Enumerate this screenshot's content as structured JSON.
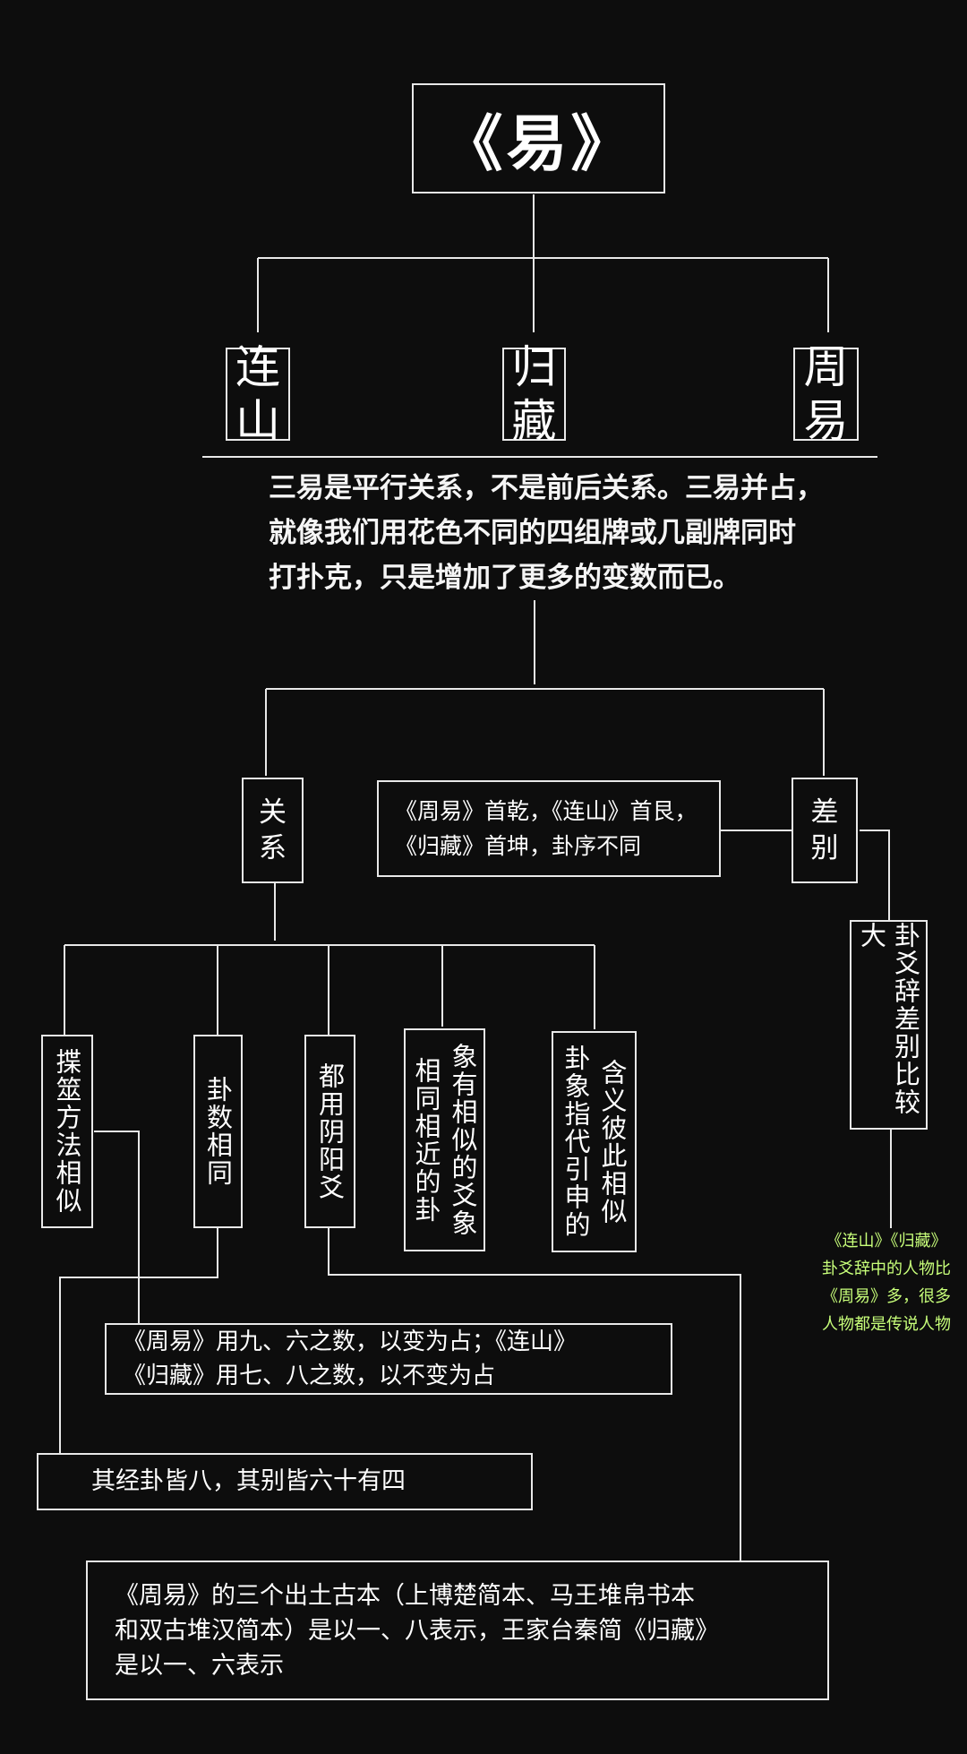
{
  "root": {
    "title": "《易》"
  },
  "books": {
    "lianshan": [
      "连",
      "山"
    ],
    "guicang": [
      "归",
      "藏"
    ],
    "zhouyi": [
      "周",
      "易"
    ]
  },
  "summary": {
    "line1": "三易是平行关系，不是前后关系。三易并占，",
    "line2": "就像我们用花色不同的四组牌或几副牌同时",
    "line3": "打扑克，只是增加了更多的变数而已。"
  },
  "relation": {
    "label": [
      "关",
      "系"
    ]
  },
  "difference": {
    "label": [
      "差",
      "别"
    ],
    "sequence_line1": "《周易》首乾，《连山》首艮，",
    "sequence_line2": "《归藏》首坤，卦序不同",
    "detail": "卦爻辞差别比较大",
    "note_line1": "《连山》《归藏》",
    "note_line2": "卦爻辞中的人物比",
    "note_line3": "《周易》多，很多",
    "note_line4": "人物都是传说人物"
  },
  "similarities": {
    "item1": "揲筮方法相似",
    "item2": "卦数相同",
    "item3": "都用阴阳爻",
    "item4_col1": "相同相近的卦",
    "item4_col2": "象有相似的爻象",
    "item5_col1": "卦象指代引申的",
    "item5_col2": "含义彼此相似"
  },
  "details": {
    "method_line1": "《周易》用九、六之数，以变为占；《连山》",
    "method_line2": "《归藏》用七、八之数，以不变为占",
    "count": "其经卦皆八，其别皆六十有四",
    "yinyang_line1": "《周易》的三个出土古本（上博楚简本、马王堆帛书本",
    "yinyang_line2": "和双古堆汉简本）是以一、八表示，王家台秦简《归藏》",
    "yinyang_line3": "是以一、六表示"
  },
  "colors": {
    "background": "#0d0d0d",
    "line": "#e8e8e8",
    "note_green": "#c8ff7a"
  }
}
